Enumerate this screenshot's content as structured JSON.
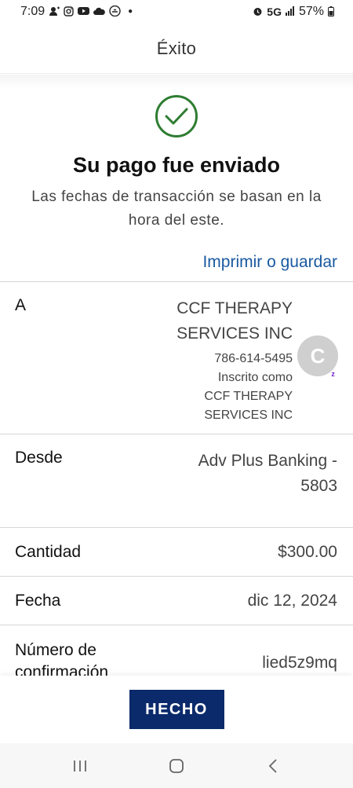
{
  "status_bar": {
    "time": "7:09",
    "network": "5G",
    "battery": "57%",
    "left_icons": [
      "person-icon",
      "instagram-icon",
      "youtube-icon",
      "cloud-icon",
      "game-controller-icon"
    ],
    "right_icons": [
      "alarm-icon",
      "signal-icon",
      "battery-icon"
    ]
  },
  "header": {
    "title": "Éxito"
  },
  "success": {
    "icon": "checkmark-icon",
    "title": "Su pago fue enviado",
    "subtitle": "Las fechas de transacción se basan en la hora del este."
  },
  "print_link": "Imprimir o guardar",
  "details": {
    "to": {
      "label": "A",
      "name": "CCF THERAPY SERVICES INC",
      "phone": "786-614-5495",
      "enrolled_as": "Inscrito como",
      "enrolled_name": "CCF THERAPY SERVICES INC",
      "avatar_letter": "C"
    },
    "from": {
      "label": "Desde",
      "value": "Adv Plus Banking - 5803"
    },
    "amount": {
      "label": "Cantidad",
      "value": "$300.00"
    },
    "date": {
      "label": "Fecha",
      "value": "dic 12, 2024"
    },
    "confirmation": {
      "label": "Número de confirmación",
      "value": "lied5z9mq"
    }
  },
  "done_button": "HECHO",
  "colors": {
    "success_green": "#2e7d32",
    "link_blue": "#1a5aa0",
    "button_navy": "#0b2a6b",
    "zelle_purple": "#6d1ed4"
  }
}
